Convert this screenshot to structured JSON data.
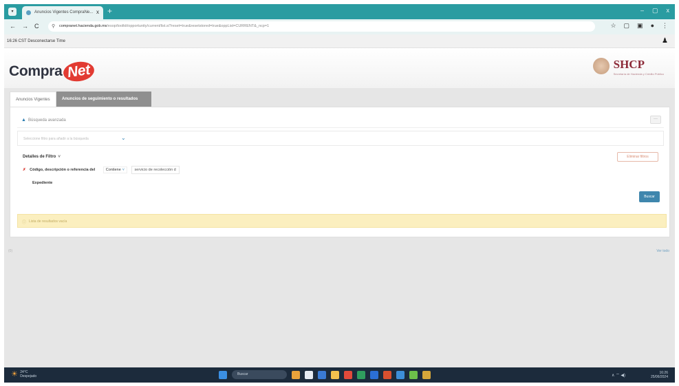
{
  "browser": {
    "tab_title": "Anuncios Vigentes CompraNe...",
    "tab_close": "x",
    "new_tab": "+",
    "menu": "▾",
    "window_buttons": [
      "–",
      "▢",
      "x"
    ],
    "nav": {
      "back": "←",
      "forward": "→",
      "reload": "C"
    },
    "url_host": "compranet.hacienda.gob.mx",
    "url_path": "/esop/toolkit/opportunity/current/list.si?reset=true&resetstored=true&oppList=CURRENT&_ncp=1",
    "toolbar_icons": [
      "☆",
      "▢",
      "▣",
      "●",
      "⋮"
    ]
  },
  "infobar": {
    "session": "16:26 CST  Desconectarse Time",
    "user_icon": "person-icon"
  },
  "brand": {
    "logo_main": "Compra",
    "logo_net": "Net",
    "agency": "SHCP",
    "agency_sub": "Secretaría de Hacienda y Crédito Público"
  },
  "tabs": [
    {
      "label": "Anuncios Vigentes",
      "active": true
    },
    {
      "label": "Anuncios de seguimiento o resultados",
      "active": false
    }
  ],
  "section": {
    "label": "Búsqueda avanzada",
    "menu_glyph": "···"
  },
  "selector": {
    "placeholder": "Seleccione filtro para añadir a la búsqueda"
  },
  "filters": {
    "title": "Detalles de Filtro",
    "delete_label": "Eliminar filtros",
    "row": {
      "field": "Código, descripción o referencia del",
      "field_line2": "Expediente",
      "operator": "Contiene",
      "value": "servicio de recolección d"
    },
    "search_label": "Buscar"
  },
  "alert": {
    "message": "Lista de resultados vacía"
  },
  "footer": {
    "left": "(0)",
    "right": "Ver todo"
  },
  "taskbar": {
    "weather_temp": "24°C",
    "weather_desc": "Despejado",
    "search_label": "Buscar",
    "time": "16:26",
    "date": "25/06/2024",
    "tray": "∧  ⌔  ◀)"
  },
  "colors": {
    "titlebar": "#2a9ca1",
    "brand_red": "#e23b32",
    "shcp": "#8c2a38",
    "button": "#3f86ad",
    "alert": "#fbefbf",
    "taskbar": "#1c2b3c"
  }
}
